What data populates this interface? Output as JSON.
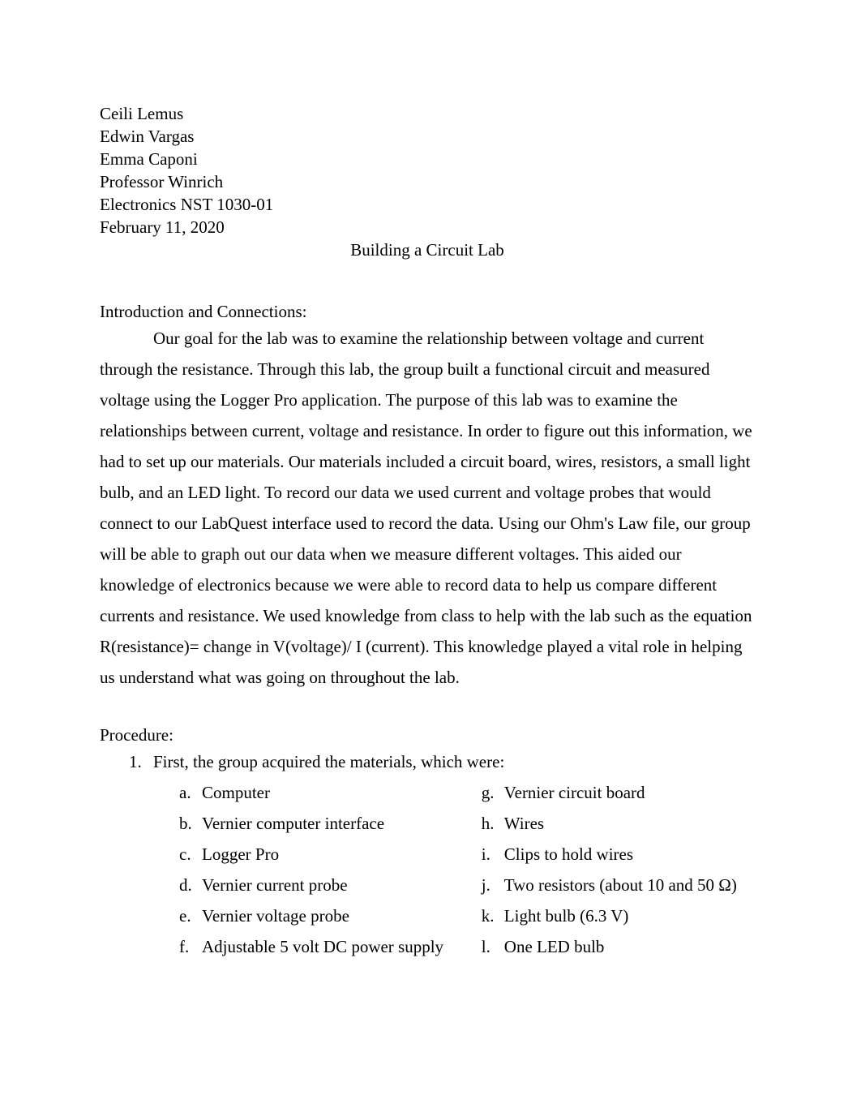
{
  "document": {
    "header_lines": [
      "Ceili Lemus",
      "Edwin Vargas",
      "Emma Caponi",
      "Professor Winrich",
      "Electronics NST 1030-01",
      "February 11, 2020"
    ],
    "title": "Building a Circuit Lab",
    "sections": {
      "introduction": {
        "heading": "Introduction and Connections:",
        "paragraph": "Our goal for the lab was to examine the relationship between voltage and current through the resistance. Through this lab, the group built a functional circuit and measured voltage using the Logger Pro application. The purpose of this lab was to examine the relationships between current, voltage and resistance. In order to figure out this information, we had to set up our materials. Our materials included a circuit board, wires, resistors, a small light bulb, and an LED light. To record our data we used current and voltage probes that would connect to our LabQuest interface used to record the data. Using our Ohm's Law file, our group will be able to graph out our data when we measure different voltages. This aided our knowledge of electronics because we were able to record data to help us compare different currents and resistance. We used knowledge from class to help with the lab such as the equation R(resistance)= change in V(voltage)/ I (current). This knowledge played a vital role in helping us understand what was going on throughout the lab."
      },
      "procedure": {
        "heading": "Procedure:",
        "steps": [
          {
            "marker": "1.",
            "text": "First, the group acquired the materials, which were:"
          }
        ],
        "materials_left": [
          {
            "marker": "a.",
            "text": "Computer"
          },
          {
            "marker": "b.",
            "text": "Vernier computer interface"
          },
          {
            "marker": "c.",
            "text": "Logger Pro"
          },
          {
            "marker": "d.",
            "text": "Vernier current probe"
          },
          {
            "marker": "e.",
            "text": "Vernier voltage probe"
          },
          {
            "marker": "f.",
            "text": "Adjustable 5 volt DC power supply"
          }
        ],
        "materials_right": [
          {
            "marker": "g.",
            "text": "Vernier circuit board"
          },
          {
            "marker": "h.",
            "text": "Wires"
          },
          {
            "marker": "i.",
            "text": "Clips to hold wires"
          },
          {
            "marker": "j.",
            "text": "Two resistors (about 10 and 50 Ω)"
          },
          {
            "marker": "k.",
            "text": "Light bulb (6.3 V)"
          },
          {
            "marker": "l.",
            "text": "One LED bulb"
          }
        ]
      }
    }
  }
}
